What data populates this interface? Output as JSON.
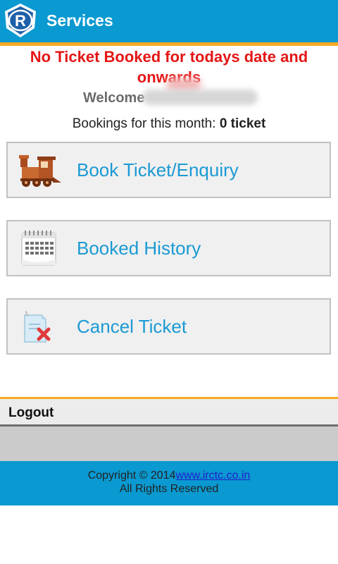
{
  "header": {
    "title": "Services",
    "logo_icon": "irctc-logo-icon",
    "background": "#0a99d0",
    "accent_line": "#f7a823"
  },
  "notice": "No Ticket Booked for todays date and onwards",
  "welcome": {
    "label": "Welcome"
  },
  "bookings": {
    "label": "Bookings for this month:",
    "count": "0 ticket"
  },
  "menu": [
    {
      "label": "Book Ticket/Enquiry",
      "icon": "train-icon"
    },
    {
      "label": "Booked History",
      "icon": "calendar-icon"
    },
    {
      "label": "Cancel Ticket",
      "icon": "cancel-ticket-icon"
    }
  ],
  "logout": {
    "label": "Logout"
  },
  "footer": {
    "copyright": "Copyright © 2014",
    "link": "www.irctc.co.in",
    "rights": "All Rights Reserved"
  }
}
